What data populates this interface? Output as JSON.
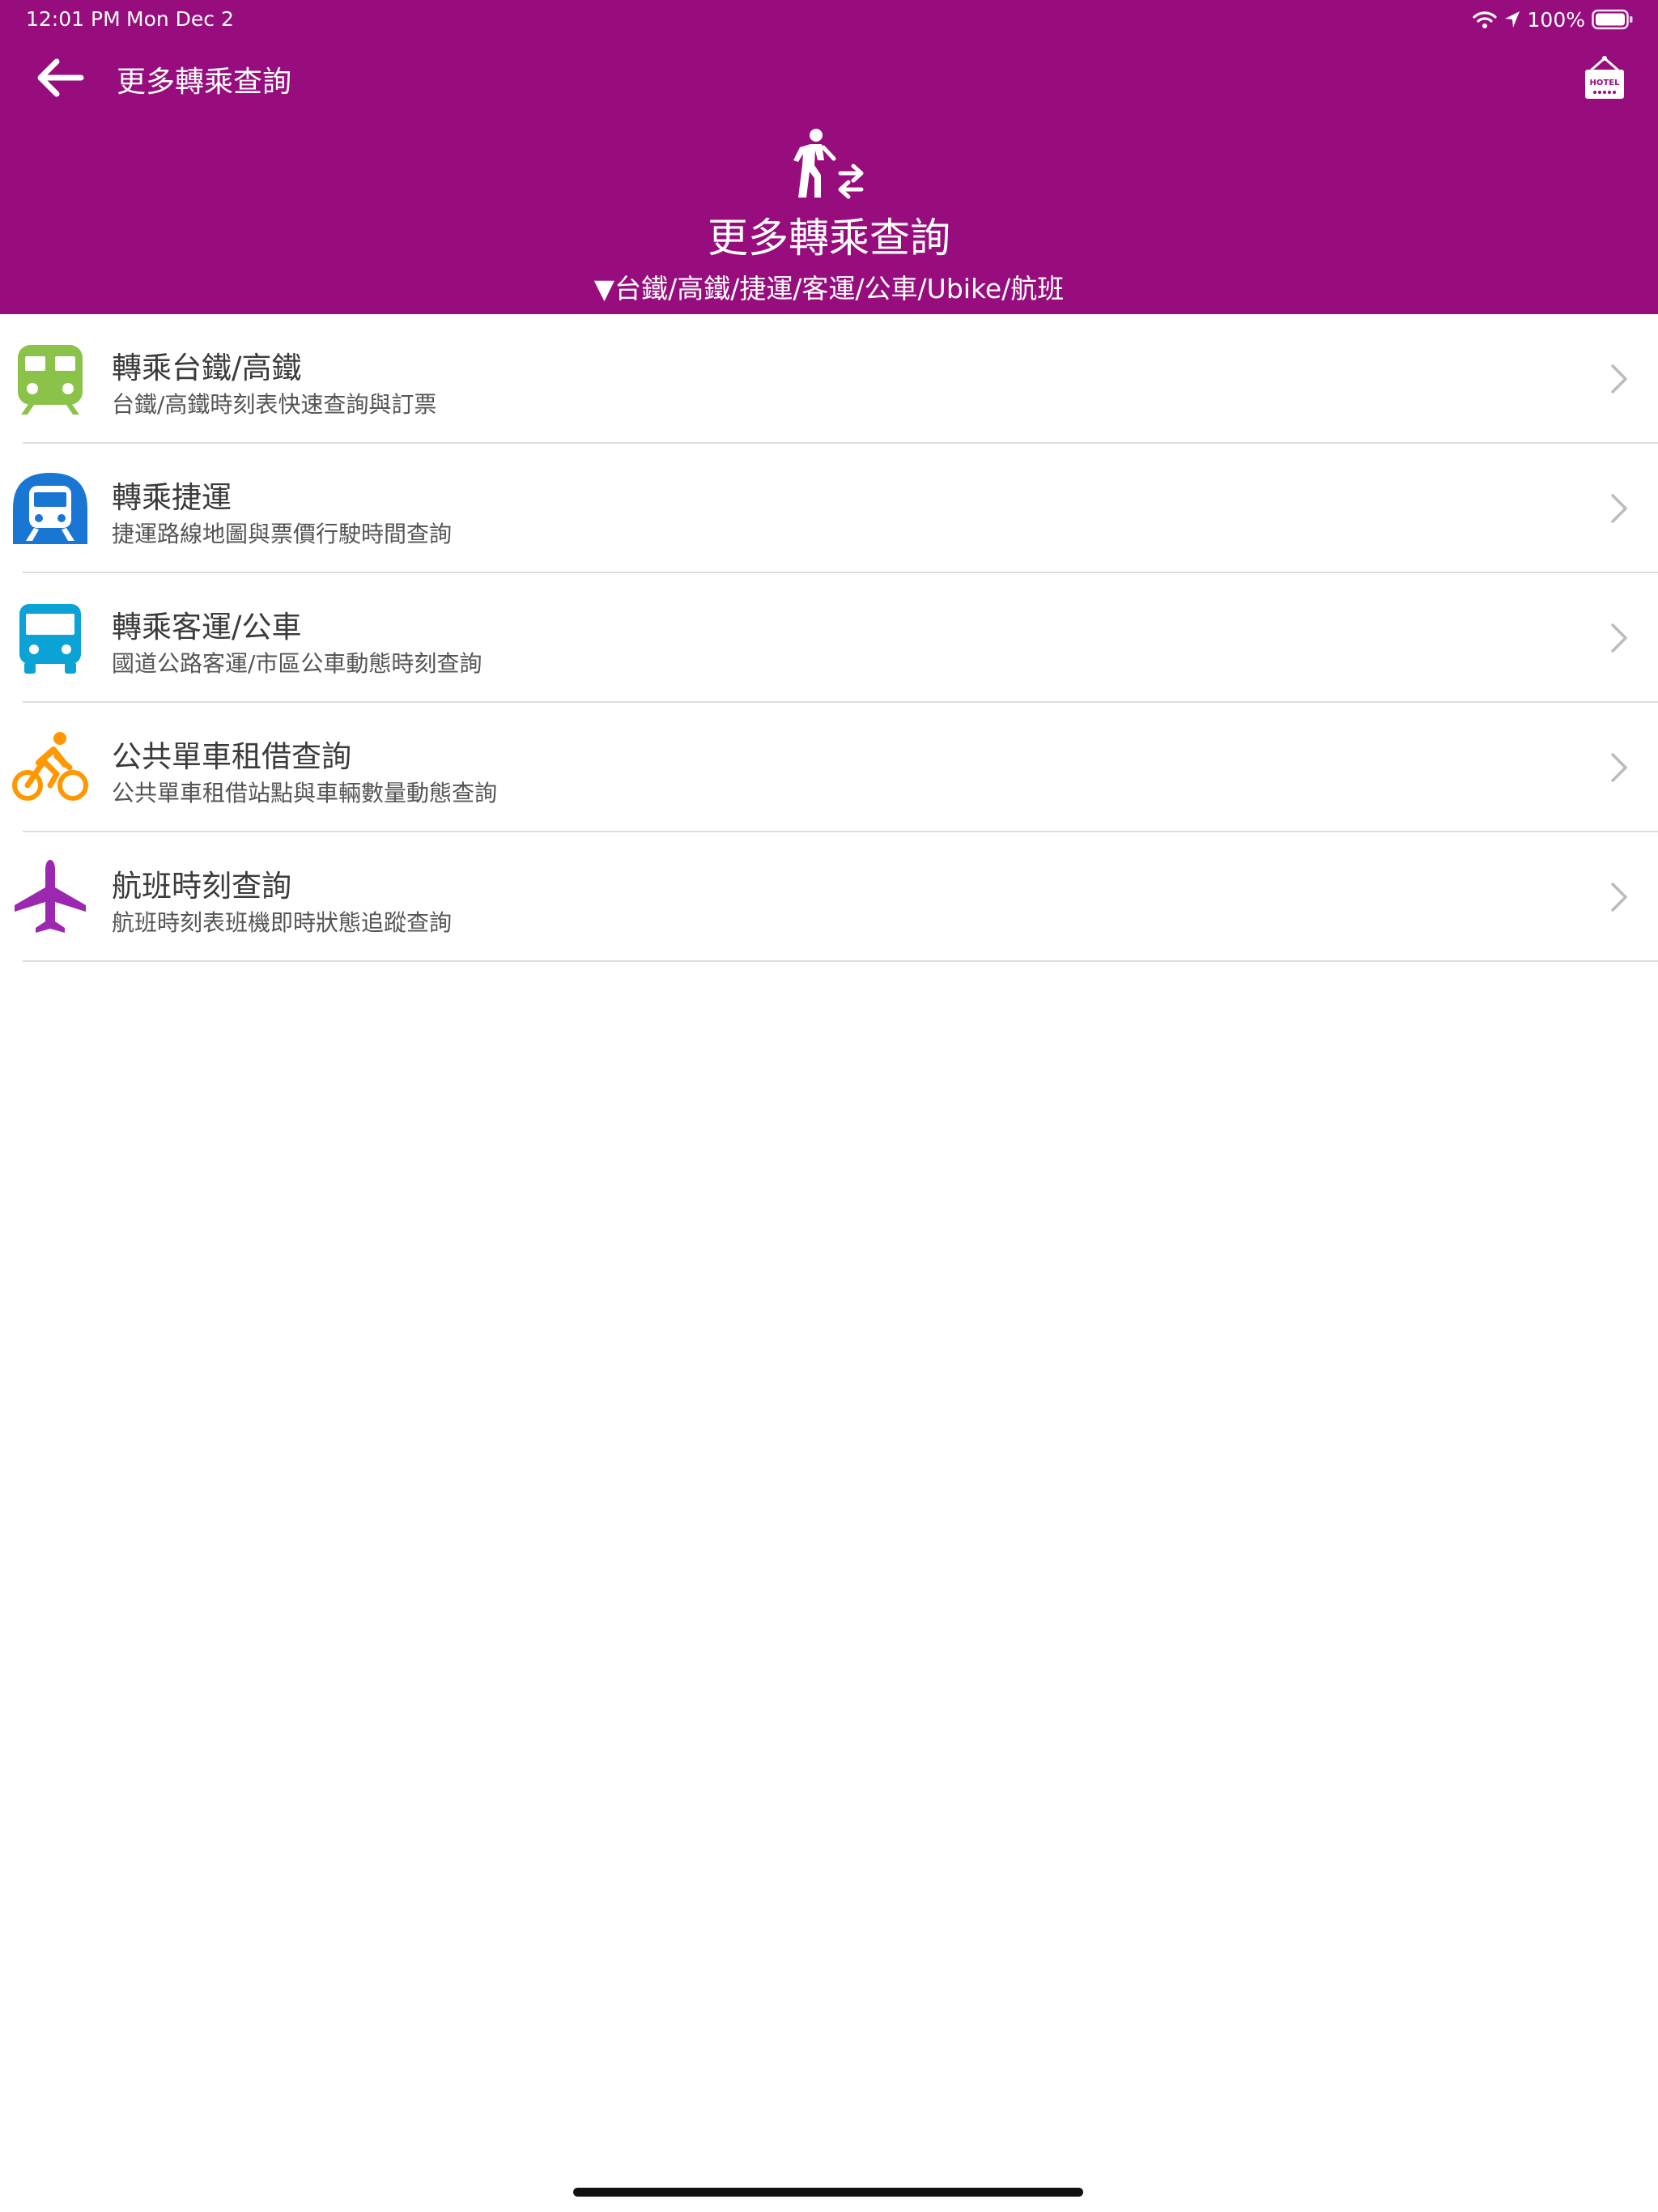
{
  "status_bar": {
    "time": "12:01 PM",
    "date": "Mon Dec 2",
    "battery": "100%",
    "icons": [
      "wifi-icon",
      "location-arrow-icon",
      "battery-icon"
    ]
  },
  "nav": {
    "back_icon": "arrow-left-icon",
    "title": "更多轉乘查詢",
    "hotel_icon": "hotel-sign-icon",
    "hotel_label": "HOTEL"
  },
  "hero": {
    "icon": "transfer-walk-icon",
    "title": "更多轉乘查詢",
    "subtitle": "▼台鐵/高鐵/捷運/客運/公車/Ubike/航班"
  },
  "items": [
    {
      "icon": "train-icon",
      "color": "#8bc34a",
      "title": "轉乘台鐵/高鐵",
      "desc": "台鐵/高鐵時刻表快速查詢與訂票"
    },
    {
      "icon": "metro-icon",
      "color": "#1976d2",
      "title": "轉乘捷運",
      "desc": "捷運路線地圖與票價行駛時間查詢"
    },
    {
      "icon": "bus-icon",
      "color": "#0ba3d6",
      "title": "轉乘客運/公車",
      "desc": "國道公路客運/市區公車動態時刻查詢"
    },
    {
      "icon": "bike-icon",
      "color": "#ff9800",
      "title": "公共單車租借查詢",
      "desc": "公共單車租借站點與車輛數量動態查詢"
    },
    {
      "icon": "airplane-icon",
      "color": "#9c27b0",
      "title": "航班時刻查詢",
      "desc": "航班時刻表班機即時狀態追蹤查詢"
    }
  ],
  "colors": {
    "header_bg": "#970d7e",
    "chevron": "#bbbbbb",
    "divider": "#dddddd"
  }
}
